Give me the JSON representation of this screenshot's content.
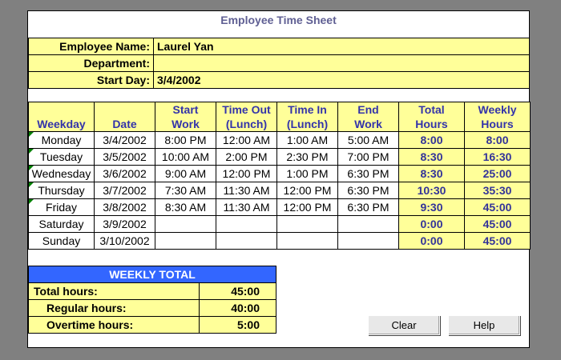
{
  "title": "Employee Time Sheet",
  "info": {
    "employee_label": "Employee Name:",
    "employee_value": "Laurel Yan",
    "department_label": "Department:",
    "department_value": "",
    "startday_label": "Start Day:",
    "startday_value": "3/4/2002"
  },
  "columns": {
    "weekday": "Weekday",
    "date": "Date",
    "start_work": [
      "Start",
      "Work"
    ],
    "time_out": [
      "Time Out",
      "(Lunch)"
    ],
    "time_in": [
      "Time In",
      "(Lunch)"
    ],
    "end_work": [
      "End",
      "Work"
    ],
    "total_hours": [
      "Total",
      "Hours"
    ],
    "weekly_hours": [
      "Weekly",
      "Hours"
    ]
  },
  "rows": [
    {
      "day": "Monday",
      "date": "3/4/2002",
      "start": "8:00 PM",
      "out": "12:00 AM",
      "in": "1:00 AM",
      "end": "5:00 AM",
      "total": "8:00",
      "weekly": "8:00"
    },
    {
      "day": "Tuesday",
      "date": "3/5/2002",
      "start": "10:00 AM",
      "out": "2:00 PM",
      "in": "2:30 PM",
      "end": "7:00 PM",
      "total": "8:30",
      "weekly": "16:30"
    },
    {
      "day": "Wednesday",
      "date": "3/6/2002",
      "start": "9:00 AM",
      "out": "12:00 PM",
      "in": "1:00 PM",
      "end": "6:30 PM",
      "total": "8:30",
      "weekly": "25:00"
    },
    {
      "day": "Thursday",
      "date": "3/7/2002",
      "start": "7:30 AM",
      "out": "11:30 AM",
      "in": "12:00 PM",
      "end": "6:30 PM",
      "total": "10:30",
      "weekly": "35:30"
    },
    {
      "day": "Friday",
      "date": "3/8/2002",
      "start": "8:30 AM",
      "out": "11:30 AM",
      "in": "12:00 PM",
      "end": "6:30 PM",
      "total": "9:30",
      "weekly": "45:00"
    },
    {
      "day": "Saturday",
      "date": "3/9/2002",
      "start": "",
      "out": "",
      "in": "",
      "end": "",
      "total": "0:00",
      "weekly": "45:00"
    },
    {
      "day": "Sunday",
      "date": "3/10/2002",
      "start": "",
      "out": "",
      "in": "",
      "end": "",
      "total": "0:00",
      "weekly": "45:00"
    }
  ],
  "weekly_total": {
    "header": "WEEKLY TOTAL",
    "total_label": "Total hours:",
    "total_value": "45:00",
    "regular_label": "Regular hours:",
    "regular_value": "40:00",
    "overtime_label": "Overtime hours:",
    "overtime_value": "5:00"
  },
  "buttons": {
    "clear": "Clear",
    "help": "Help"
  },
  "colors": {
    "highlight": "#ffff99",
    "header_text": "#3333aa",
    "weekly_header": "#3366ff"
  }
}
